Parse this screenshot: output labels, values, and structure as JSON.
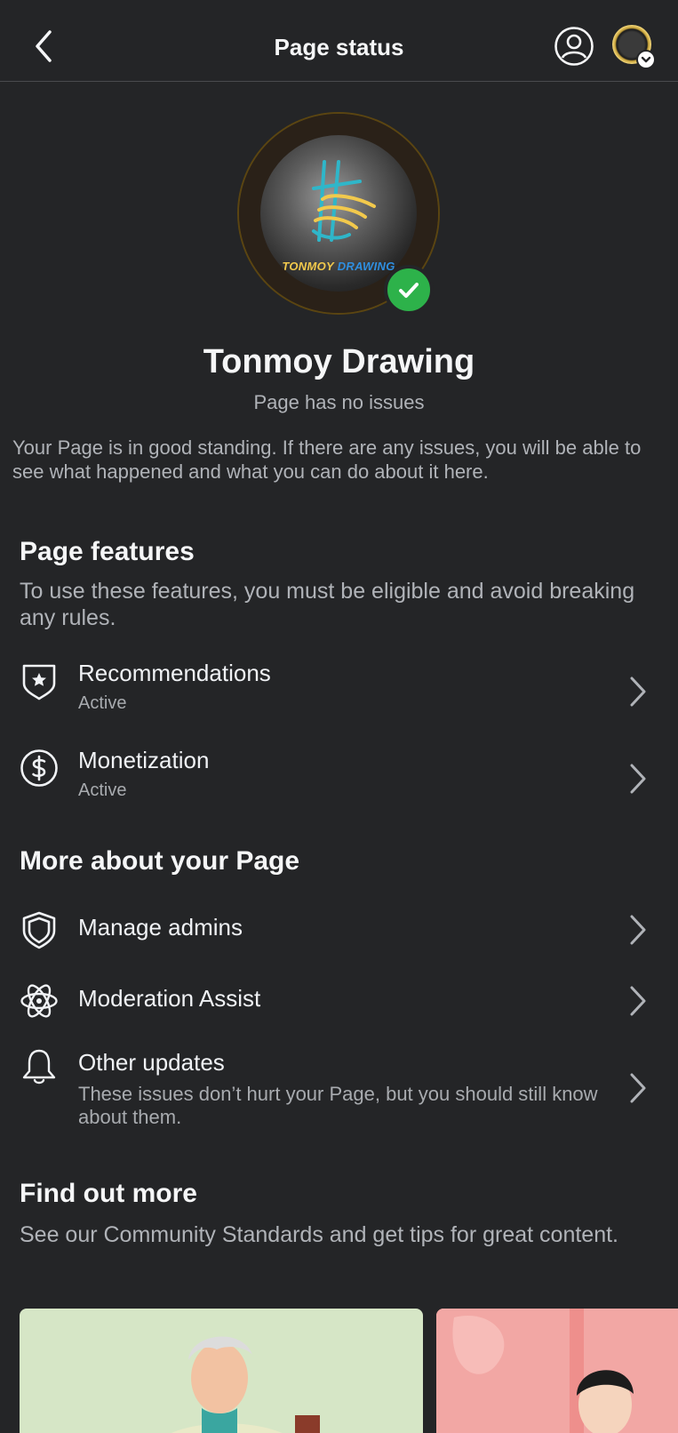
{
  "header": {
    "title": "Page status"
  },
  "profile": {
    "name": "Tonmoy Drawing",
    "status": "Page has no issues",
    "description": "Your Page is in good standing. If there are any issues, you will be able to see what happened and what you can do about it here.",
    "logo_text_1": "TONMOY",
    "logo_text_2": "DRAWING"
  },
  "page_features": {
    "title": "Page features",
    "subtitle": "To use these features, you must be eligible and avoid breaking any rules.",
    "items": [
      {
        "label": "Recommendations",
        "status": "Active",
        "icon": "shield-star-icon"
      },
      {
        "label": "Monetization",
        "status": "Active",
        "icon": "dollar-circle-icon"
      }
    ]
  },
  "more_about": {
    "title": "More about your Page",
    "items": [
      {
        "label": "Manage admins",
        "icon": "shield-icon"
      },
      {
        "label": "Moderation Assist",
        "icon": "atom-icon"
      },
      {
        "label": "Other updates",
        "description": "These issues don’t hurt your Page, but you should still know about them.",
        "icon": "bell-icon"
      }
    ]
  },
  "find_out_more": {
    "title": "Find out more",
    "subtitle": "See our Community Standards and get tips for great content."
  },
  "colors": {
    "background": "#242527",
    "verified": "#2db24a",
    "gold": "#d4af37"
  }
}
